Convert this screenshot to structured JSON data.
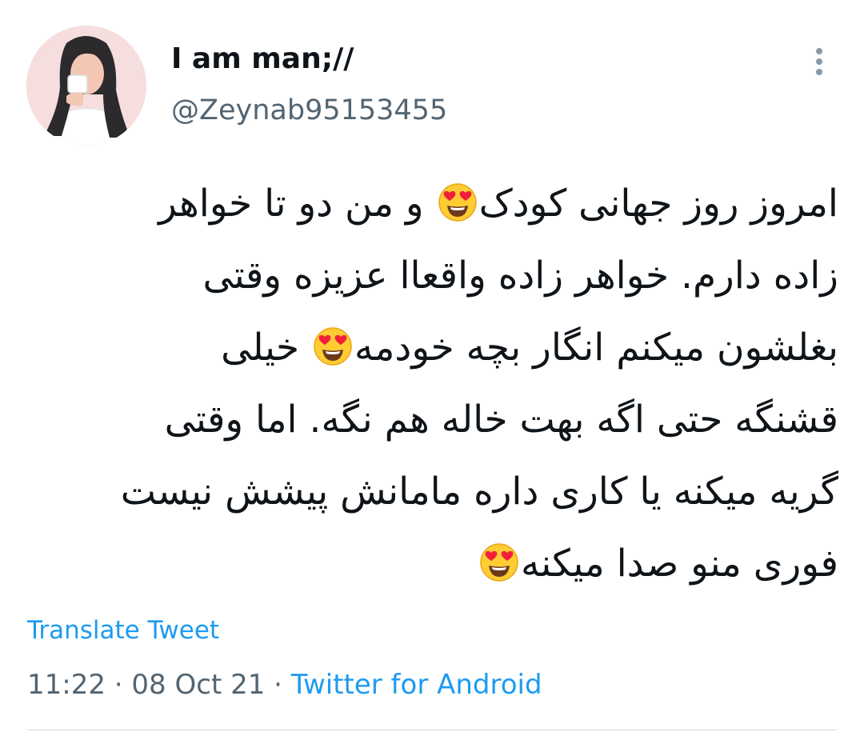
{
  "tweet": {
    "display_name": "I am man;//",
    "handle": "@Zeynab95153455",
    "lines": [
      [
        "امروز روز جهانی کودک",
        "heart-eyes",
        " و من دو تا خواهر"
      ],
      [
        "زاده دارم. خواهر زاده واقعاا عزیزه وقتی"
      ],
      [
        "بغلشون میکنم انگار بچه خودمه",
        "heart-eyes",
        " خیلی"
      ],
      [
        "قشنگه حتی اگه بهت خاله هم نگه. اما وقتی"
      ],
      [
        "گریه میکنه یا کاری داره مامانش پیشش نیست"
      ],
      [
        "فوری منو صدا میکنه",
        "heart-eyes"
      ]
    ],
    "translate_label": "Translate Tweet",
    "time": "11:22",
    "separator": " · ",
    "date": "08 Oct 21",
    "source": "Twitter for Android"
  },
  "icons": {
    "more": "more-vertical-icon",
    "emoji": "smiling-face-with-heart-eyes"
  },
  "colors": {
    "link": "#1d9bf0",
    "secondary_text": "#536471",
    "primary_text": "#0f1419"
  }
}
